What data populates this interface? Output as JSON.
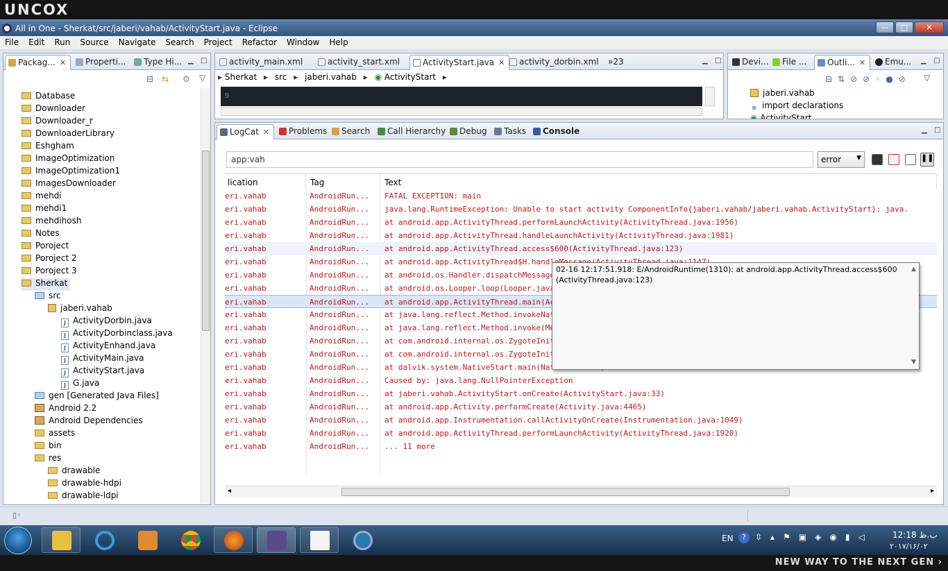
{
  "brand": {
    "logo": "UNCOX"
  },
  "window": {
    "title": "All in One - Sherkat/src/jaberi/vahab/ActivityStart.java - Eclipse",
    "minimize": "—",
    "maximize": "□",
    "close": "✕"
  },
  "menu": [
    "File",
    "Edit",
    "Run",
    "Source",
    "Navigate",
    "Search",
    "Project",
    "Refactor",
    "Window",
    "Help"
  ],
  "left_panel": {
    "tabs": [
      {
        "label": "Packag..."
      },
      {
        "label": "Properti..."
      },
      {
        "label": "Type Hi..."
      }
    ],
    "tree": [
      {
        "label": "Database",
        "icon": "folder-icon"
      },
      {
        "label": "Downloader",
        "icon": "folder-icon"
      },
      {
        "label": "Downloader_r",
        "icon": "folder-icon"
      },
      {
        "label": "DownloaderLibrary",
        "icon": "folder-icon"
      },
      {
        "label": "Eshgham",
        "icon": "folder-icon"
      },
      {
        "label": "ImageOptimization",
        "icon": "folder-icon"
      },
      {
        "label": "ImageOptimization1",
        "icon": "folder-icon"
      },
      {
        "label": "ImagesDownloader",
        "icon": "folder-icon"
      },
      {
        "label": "mehdi",
        "icon": "folder-icon"
      },
      {
        "label": "mehdi1",
        "icon": "folder-icon"
      },
      {
        "label": "mehdihosh",
        "icon": "folder-icon"
      },
      {
        "label": "Notes",
        "icon": "folder-icon"
      },
      {
        "label": "Poroject",
        "icon": "folder-icon"
      },
      {
        "label": "Poroject 2",
        "icon": "folder-icon"
      },
      {
        "label": "Poroject 3",
        "icon": "folder-icon"
      },
      {
        "label": "Sherkat",
        "icon": "open-folder-icon"
      },
      {
        "label": "src",
        "icon": "source-folder-icon"
      },
      {
        "label": "jaberi.vahab",
        "icon": "package-icon"
      },
      {
        "label": "ActivityDorbin.java",
        "icon": "java-file-icon"
      },
      {
        "label": "ActivityDorbinclass.java",
        "icon": "java-file-icon"
      },
      {
        "label": "ActivityEnhand.java",
        "icon": "java-file-icon"
      },
      {
        "label": "ActivityMain.java",
        "icon": "java-file-icon"
      },
      {
        "label": "ActivityStart.java",
        "icon": "java-file-icon"
      },
      {
        "label": "G.java",
        "icon": "java-file-icon"
      },
      {
        "label": "gen [Generated Java Files]",
        "icon": "source-folder-icon"
      },
      {
        "label": "Android 2.2",
        "icon": "library-icon"
      },
      {
        "label": "Android Dependencies",
        "icon": "library-icon"
      },
      {
        "label": "assets",
        "icon": "folder-icon"
      },
      {
        "label": "bin",
        "icon": "folder-icon"
      },
      {
        "label": "res",
        "icon": "folder-icon"
      },
      {
        "label": "drawable",
        "icon": "folder-icon"
      },
      {
        "label": "drawable-hdpi",
        "icon": "folder-icon"
      },
      {
        "label": "drawable-ldpi",
        "icon": "folder-icon"
      }
    ]
  },
  "editor": {
    "tabs": [
      {
        "label": "activity_main.xml"
      },
      {
        "label": "activity_start.xml"
      },
      {
        "label": "ActivityStart.java"
      },
      {
        "label": "activity_dorbin.xml"
      },
      {
        "label": "»23"
      }
    ],
    "breadcrumb": [
      "Sherkat",
      "src",
      "jaberi.vahab",
      "ActivityStart"
    ],
    "line_number": "9"
  },
  "outline": {
    "tabs": [
      {
        "label": "Devi..."
      },
      {
        "label": "File ..."
      },
      {
        "label": "Outli..."
      },
      {
        "label": "Emu..."
      }
    ],
    "items": [
      "jaberi.vahab",
      "import declarations",
      "ActivityStart"
    ]
  },
  "bottom_panel": {
    "tabs": [
      {
        "label": "LogCat"
      },
      {
        "label": "Problems"
      },
      {
        "label": "Search"
      },
      {
        "label": "Call Hierarchy"
      },
      {
        "label": "Debug"
      },
      {
        "label": "Tasks"
      },
      {
        "label": "Console"
      }
    ],
    "filter_value": "app:vah",
    "level": "error",
    "columns": [
      "lication",
      "Tag",
      "Text"
    ],
    "rows": [
      {
        "app": "eri.vahab",
        "tag": "AndroidRun...",
        "text": "FATAL EXCEPTION: main"
      },
      {
        "app": "eri.vahab",
        "tag": "AndroidRun...",
        "text": "java.lang.RuntimeException: Unable to start activity ComponentInfo{jaberi.vahab/jaberi.vahab.ActivityStart}: java."
      },
      {
        "app": "eri.vahab",
        "tag": "AndroidRun...",
        "text": "at android.app.ActivityThread.performLaunchActivity(ActivityThread.java:1956)"
      },
      {
        "app": "eri.vahab",
        "tag": "AndroidRun...",
        "text": "at android.app.ActivityThread.handleLaunchActivity(ActivityThread.java:1981)"
      },
      {
        "app": "eri.vahab",
        "tag": "AndroidRun...",
        "text": "at android.app.ActivityThread.access$600(ActivityThread.java:123)"
      },
      {
        "app": "eri.vahab",
        "tag": "AndroidRun...",
        "text": "at android.app.ActivityThread$H.handleMessage(ActivityThread.java:1147)"
      },
      {
        "app": "eri.vahab",
        "tag": "AndroidRun...",
        "text": "at android.os.Handler.dispatchMessage(Handler.java:99)"
      },
      {
        "app": "eri.vahab",
        "tag": "AndroidRun...",
        "text": "at android.os.Looper.loop(Looper.java:137)"
      },
      {
        "app": "eri.vahab",
        "tag": "AndroidRun...",
        "text": "at android.app.ActivityThread.main(ActivityThread.java:4424)"
      },
      {
        "app": "eri.vahab",
        "tag": "AndroidRun...",
        "text": "at java.lang.reflect.Method.invokeNative(Native Method)"
      },
      {
        "app": "eri.vahab",
        "tag": "AndroidRun...",
        "text": "at java.lang.reflect.Method.invoke(Method.java:511)"
      },
      {
        "app": "eri.vahab",
        "tag": "AndroidRun...",
        "text": "at com.android.internal.os.ZygoteInit$MethodAndArgsCaller.run(ZygoteInit.java:784)"
      },
      {
        "app": "eri.vahab",
        "tag": "AndroidRun...",
        "text": "at com.android.internal.os.ZygoteInit.main(ZygoteInit.java:551)"
      },
      {
        "app": "eri.vahab",
        "tag": "AndroidRun...",
        "text": "at dalvik.system.NativeStart.main(Native Method)"
      },
      {
        "app": "eri.vahab",
        "tag": "AndroidRun...",
        "text": "Caused by: java.lang.NullPointerException"
      },
      {
        "app": "eri.vahab",
        "tag": "AndroidRun...",
        "text": "at jaberi.vahab.ActivityStart.onCreate(ActivityStart.java:33)"
      },
      {
        "app": "eri.vahab",
        "tag": "AndroidRun...",
        "text": "at android.app.Activity.performCreate(Activity.java:4465)"
      },
      {
        "app": "eri.vahab",
        "tag": "AndroidRun...",
        "text": "at android.app.Instrumentation.callActivityOnCreate(Instrumentation.java:1049)"
      },
      {
        "app": "eri.vahab",
        "tag": "AndroidRun...",
        "text": "at android.app.ActivityThread.performLaunchActivity(ActivityThread.java:1920)"
      },
      {
        "app": "eri.vahab",
        "tag": "AndroidRun...",
        "text": "... 11 more"
      }
    ],
    "tooltip": {
      "line1": "02-16 12:17:51.918: E/AndroidRuntime(1310):      at android.app.ActivityThread.access$600",
      "line2": "(ActivityThread.java:123)"
    }
  },
  "taskbar": {
    "lang": "EN",
    "clock_time": "12:18 ب.ظ",
    "clock_date": "۲۰۱۷/۱۶/۰۲",
    "apps": [
      "explorer-icon",
      "internet-explorer-icon",
      "media-player-icon",
      "chrome-icon",
      "firefox-icon",
      "java-ee-ide-icon",
      "notepad-icon",
      "video-icon"
    ]
  },
  "footer": {
    "text": "NEW WAY TO THE NEXT GEN ›"
  },
  "colors": {
    "error_text": "#c01818",
    "title_bar": "#34547c",
    "taskbar": "#16304c"
  }
}
